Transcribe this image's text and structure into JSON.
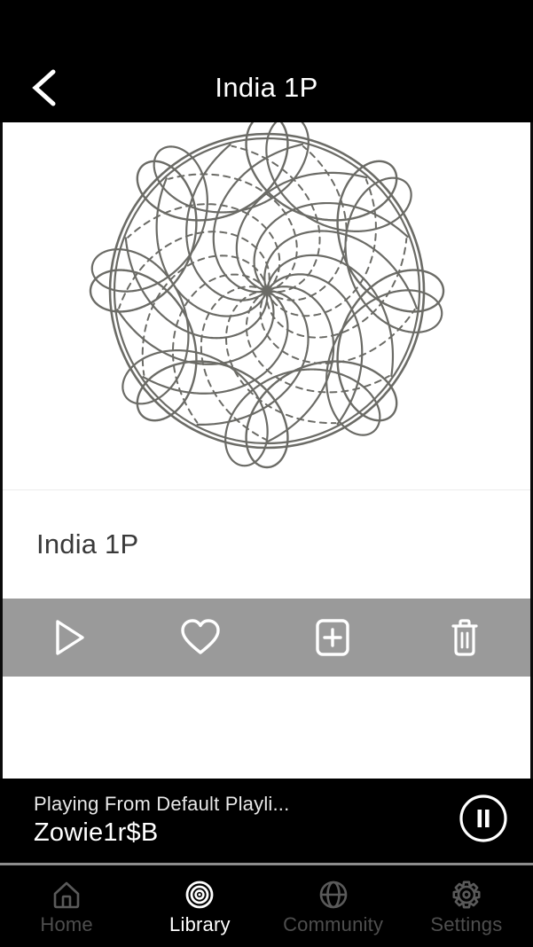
{
  "header": {
    "title": "India 1P",
    "back_icon": "chevron-left-icon"
  },
  "artwork": {
    "type": "spirograph-pattern",
    "stroke_color": "#6b6b66",
    "background": "#ffffff",
    "alt": "India 1P spirograph design"
  },
  "item": {
    "title": "India 1P"
  },
  "actions": [
    {
      "name": "play",
      "icon": "play-icon",
      "label": "Play"
    },
    {
      "name": "favorite",
      "icon": "heart-icon",
      "label": "Favorite"
    },
    {
      "name": "add-to-playlist",
      "icon": "plus-box-icon",
      "label": "Add to playlist"
    },
    {
      "name": "delete",
      "icon": "trash-icon",
      "label": "Delete"
    }
  ],
  "action_bar": {
    "background": "#9a9a9a",
    "icon_color": "#ffffff"
  },
  "now_playing": {
    "source": "Playing From Default Playli...",
    "track": "Zowie1r$B",
    "button_icon": "pause-circle-icon"
  },
  "bottom_nav": {
    "items": [
      {
        "label": "Home",
        "icon": "home-icon",
        "active": false
      },
      {
        "label": "Library",
        "icon": "target-icon",
        "active": true
      },
      {
        "label": "Community",
        "icon": "globe-icon",
        "active": false
      },
      {
        "label": "Settings",
        "icon": "gear-icon",
        "active": false
      }
    ],
    "active_color": "#ffffff",
    "inactive_color": "#4e4e4e"
  }
}
